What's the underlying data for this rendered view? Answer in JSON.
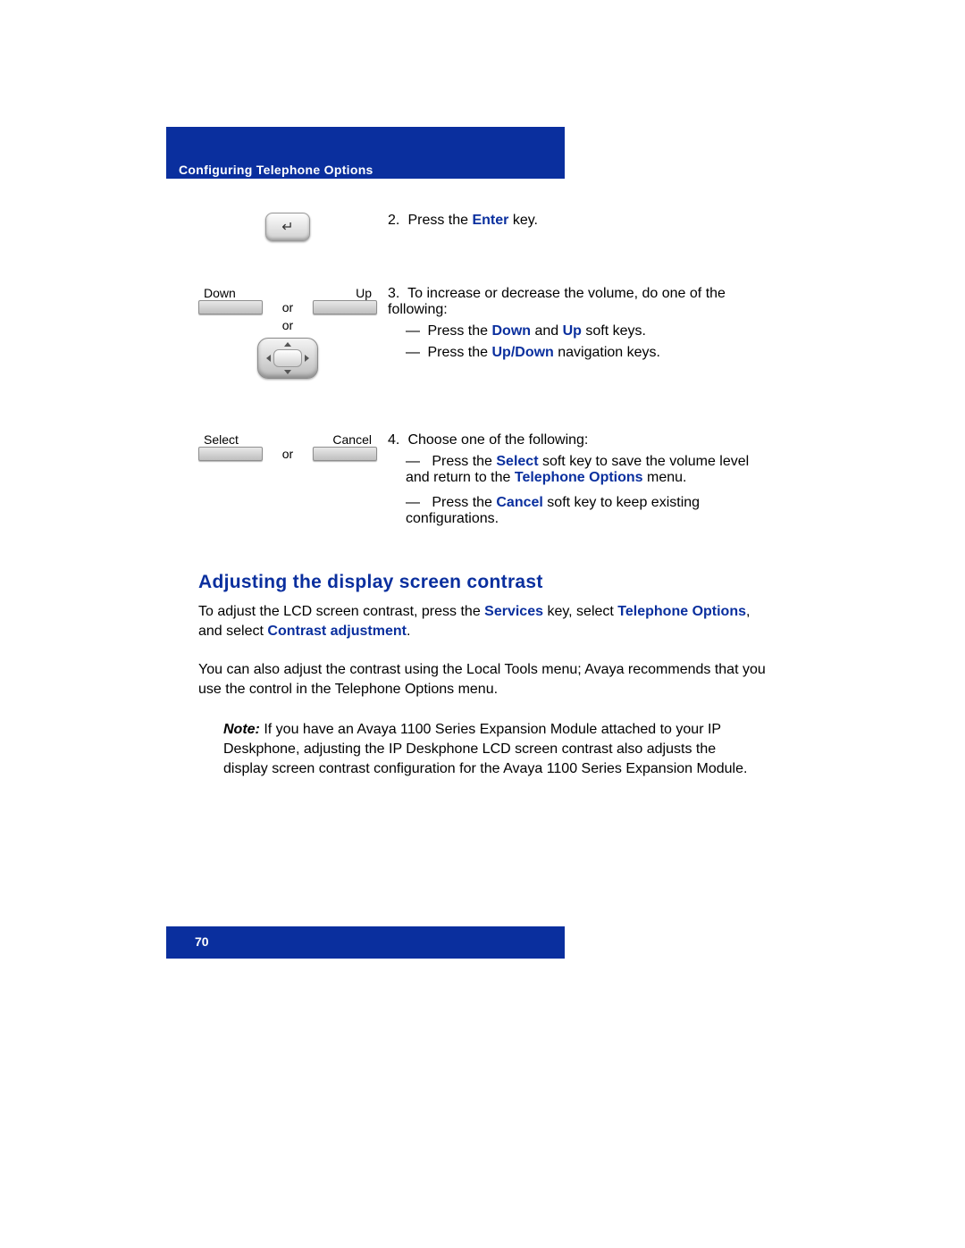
{
  "header": {
    "title": "Configuring Telephone Options"
  },
  "steps": {
    "s2": {
      "num": "2.",
      "text_a": "Press the ",
      "enter": "Enter",
      "text_b": " key."
    },
    "s3": {
      "num": "3.",
      "intro": "To increase or decrease the volume, do one of the following:",
      "bullet1_a": "Press the ",
      "down": "Down",
      "and": " and ",
      "up": "Up",
      "bullet1_b": " soft keys.",
      "bullet2_a": "Press the ",
      "updown": "Up/Down",
      "bullet2_b": " navigation keys.",
      "labels": {
        "down": "Down",
        "up": "Up",
        "or": "or"
      }
    },
    "s4": {
      "num": "4.",
      "intro": "Choose one of the following:",
      "b1_a": "Press the ",
      "select": "Select",
      "b1_b": " soft key to save the volume level and return to the ",
      "telopts": "Telephone Options",
      "b1_c": " menu.",
      "b2_a": "Press the ",
      "cancel": "Cancel",
      "b2_b": " soft key to keep existing configurations.",
      "labels": {
        "select": "Select",
        "cancel": "Cancel",
        "or": "or"
      }
    }
  },
  "section": {
    "heading": "Adjusting the display screen contrast",
    "p1_a": "To adjust the LCD screen contrast, press the ",
    "services": "Services",
    "p1_b": " key, select ",
    "telopts": "Telephone Options",
    "p1_c": ", and select ",
    "contrast": "Contrast adjustment",
    "p1_d": ".",
    "p2": "You can also adjust the contrast using the Local Tools menu; Avaya recommends that you use the control in the Telephone Options menu.",
    "note_label": "Note:",
    "note_body": " If you have an Avaya 1100 Series Expansion Module attached to your IP Deskphone, adjusting the IP Deskphone LCD screen contrast also adjusts the display screen contrast configuration for the Avaya 1100 Series Expansion Module."
  },
  "footer": {
    "page": "70"
  }
}
